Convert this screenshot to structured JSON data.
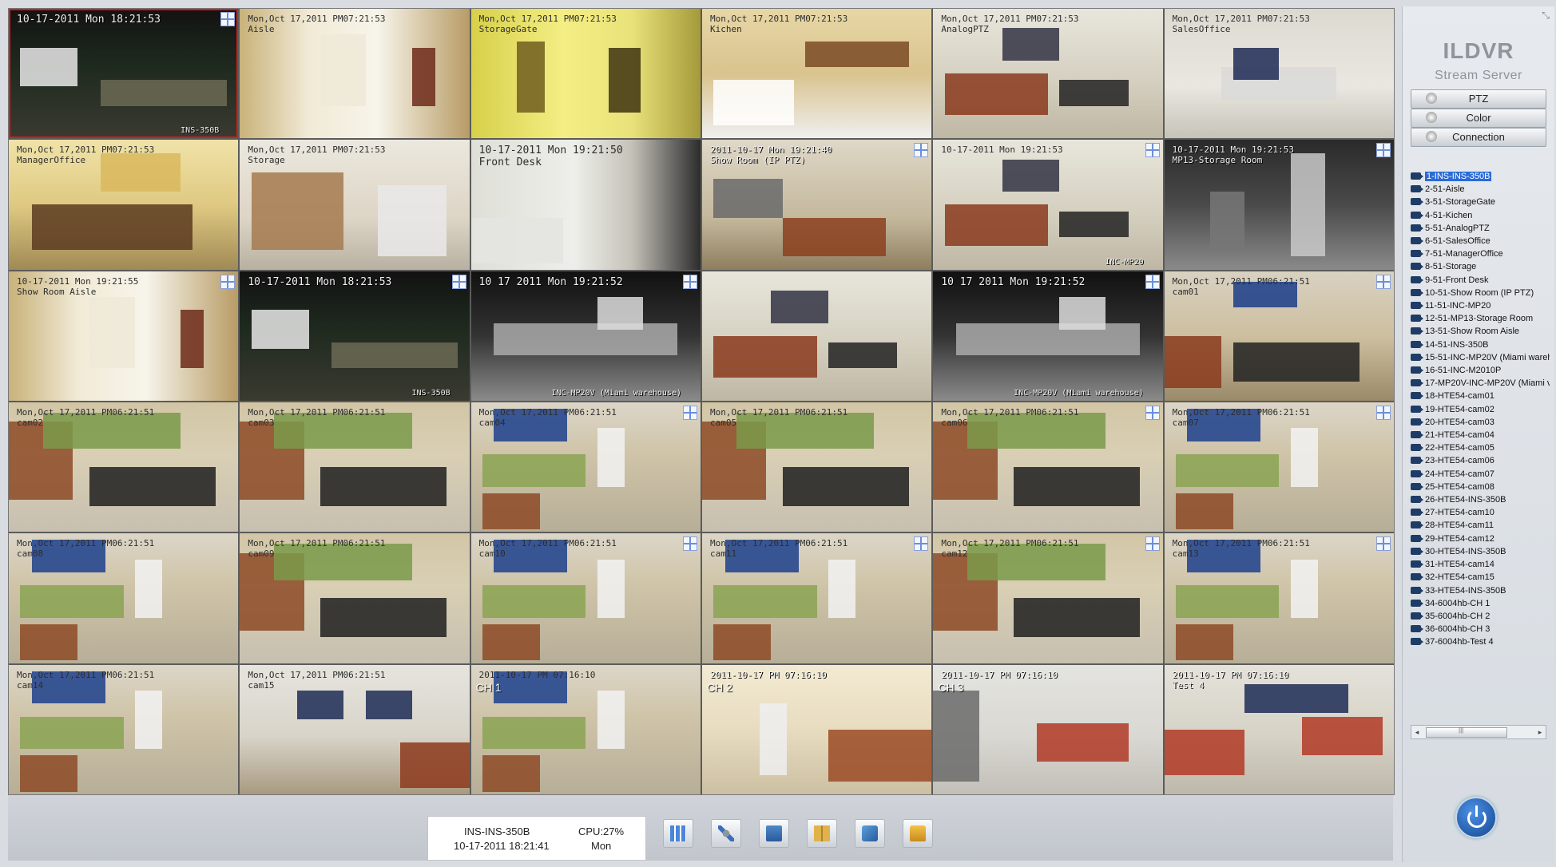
{
  "tiles": [
    {
      "overlay": "10-17-2011 Mon 18:21:53",
      "footer": "INS-350B",
      "style": "night"
    },
    {
      "overlay": "Mon,Oct 17,2011 PM07:21:53\nAisle",
      "footer": "",
      "style": "hall"
    },
    {
      "overlay": "Mon,Oct 17,2011 PM07:21:53\nStorageGate",
      "footer": "",
      "style": "yellowhall"
    },
    {
      "overlay": "Mon,Oct 17,2011 PM07:21:53\nKichen",
      "footer": "",
      "style": "kitchen"
    },
    {
      "overlay": "Mon,Oct 17,2011 PM07:21:53\nAnalogPTZ",
      "footer": "",
      "style": "showroom"
    },
    {
      "overlay": "Mon,Oct 17,2011 PM07:21:53\nSalesOffice",
      "footer": "",
      "style": "office"
    },
    {
      "overlay": "Mon,Oct 17,2011 PM07:21:53\nManagerOffice",
      "footer": "",
      "style": "managerroom"
    },
    {
      "overlay": "Mon,Oct 17,2011 PM07:21:53\nStorage",
      "footer": "",
      "style": "storage"
    },
    {
      "overlay": "10-17-2011 Mon 19:21:50\nFront Desk",
      "footer": "",
      "style": "frontdesk"
    },
    {
      "overlay": "2011-10-17 Mon 19:21:40\nShow Room (IP PTZ)",
      "footer": "",
      "style": "showroom2"
    },
    {
      "overlay": "10-17-2011 Mon 19:21:53",
      "footer": "INC-MP20",
      "style": "showroom"
    },
    {
      "overlay": "10-17-2011 Mon 19:21:53\nMP13-Storage Room",
      "footer": "",
      "style": "darkstorage"
    },
    {
      "overlay": "10-17-2011 Mon 19:21:55\nShow Room Aisle",
      "footer": "",
      "style": "hall"
    },
    {
      "overlay": "10-17-2011 Mon 18:21:53",
      "footer": "INS-350B",
      "style": "night"
    },
    {
      "overlay": "10 17 2011 Mon 19:21:52",
      "footer": "INC-MP20V (Miami warehouse)",
      "style": "bw"
    },
    {
      "overlay": "",
      "footer": "",
      "style": "showroom"
    },
    {
      "overlay": "10 17 2011 Mon 19:21:52",
      "footer": "INC-MP20V (Miami warehouse)",
      "style": "bw"
    },
    {
      "overlay": "Mon,Oct 17,2011 PM06:21:51\ncam01",
      "footer": "",
      "style": "showroomtv"
    },
    {
      "overlay": "Mon,Oct 17,2011 PM06:21:51\ncam02",
      "footer": "",
      "style": "sofa"
    },
    {
      "overlay": "Mon,Oct 17,2011 PM06:21:51\ncam03",
      "footer": "",
      "style": "sofa"
    },
    {
      "overlay": "Mon,Oct 17,2011 PM06:21:51\ncam04",
      "footer": "",
      "style": "tvman"
    },
    {
      "overlay": "Mon,Oct 17,2011 PM06:21:51\ncam05",
      "footer": "",
      "style": "sofa"
    },
    {
      "overlay": "Mon,Oct 17,2011 PM06:21:51\ncam06",
      "footer": "",
      "style": "sofa"
    },
    {
      "overlay": "Mon,Oct 17,2011 PM06:21:51\ncam07",
      "footer": "",
      "style": "tvman"
    },
    {
      "overlay": "Mon,Oct 17,2011 PM06:21:51\ncam08",
      "footer": "",
      "style": "tvman"
    },
    {
      "overlay": "Mon,Oct 17,2011 PM06:21:51\ncam09",
      "footer": "",
      "style": "sofa"
    },
    {
      "overlay": "Mon,Oct 17,2011 PM06:21:51\ncam10",
      "footer": "",
      "style": "tvman"
    },
    {
      "overlay": "Mon,Oct 17,2011 PM06:21:51\ncam11",
      "footer": "",
      "style": "tvman"
    },
    {
      "overlay": "Mon,Oct 17,2011 PM06:21:51\ncam12",
      "footer": "",
      "style": "sofa"
    },
    {
      "overlay": "Mon,Oct 17,2011 PM06:21:51\ncam13",
      "footer": "",
      "style": "tvman"
    },
    {
      "overlay": "Mon,Oct 17,2011 PM06:21:51\ncam14",
      "footer": "",
      "style": "tvman"
    },
    {
      "overlay": "Mon,Oct 17,2011 PM06:21:51\ncam15",
      "footer": "",
      "style": "wall"
    },
    {
      "overlay": "2011-10-17 PM 07:16:10",
      "ch": "CH 1",
      "footer": "",
      "style": "tvman"
    },
    {
      "overlay": "2011-10-17 PM 07:16:10",
      "ch": "CH 2",
      "footer": "",
      "style": "bright"
    },
    {
      "overlay": "2011-10-17 PM 07:16:10",
      "ch": "CH 3",
      "footer": "",
      "style": "redsofa"
    },
    {
      "overlay": "2011-10-17 PM 07:16:10\nTest 4",
      "footer": "",
      "style": "redsofa2"
    }
  ],
  "panel": {
    "brand_title": "ILDVR",
    "brand_subtitle": "Stream Server",
    "close_glyph": "⤡",
    "buttons": [
      "PTZ",
      "Color",
      "Connection"
    ],
    "cameras": [
      "1-INS-INS-350B",
      "2-51-Aisle",
      "3-51-StorageGate",
      "4-51-Kichen",
      "5-51-AnalogPTZ",
      "6-51-SalesOffice",
      "7-51-ManagerOffice",
      "8-51-Storage",
      "9-51-Front Desk",
      "10-51-Show Room (IP PTZ)",
      "11-51-INC-MP20",
      "12-51-MP13-Storage Room",
      "13-51-Show Room Aisle",
      "14-51-INS-350B",
      "15-51-INC-MP20V (Miami wareh",
      "16-51-INC-M2010P",
      "17-MP20V-INC-MP20V (Miami v",
      "18-HTE54-cam01",
      "19-HTE54-cam02",
      "20-HTE54-cam03",
      "21-HTE54-cam04",
      "22-HTE54-cam05",
      "23-HTE54-cam06",
      "24-HTE54-cam07",
      "25-HTE54-cam08",
      "26-HTE54-INS-350B",
      "27-HTE54-cam10",
      "28-HTE54-cam11",
      "29-HTE54-cam12",
      "30-HTE54-INS-350B",
      "31-HTE54-cam14",
      "32-HTE54-cam15",
      "33-HTE54-INS-350B",
      "34-6004hb-CH 1",
      "35-6004hb-CH 2",
      "36-6004hb-CH 3",
      "37-6004hb-Test 4"
    ]
  },
  "status": {
    "device": "INS-INS-350B",
    "datetime": "10-17-2011 18:21:41",
    "cpu": "CPU:27%",
    "day": "Mon"
  },
  "toolbar_icons": [
    "layout-grid-icon",
    "settings-tools-icon",
    "search-playback-icon",
    "log-book-icon",
    "network-config-icon",
    "lock-icon"
  ]
}
